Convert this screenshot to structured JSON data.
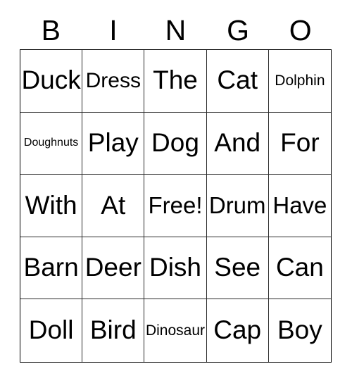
{
  "card": {
    "header_letters": [
      "B",
      "I",
      "N",
      "G",
      "O"
    ],
    "columns": 5,
    "rows": 5,
    "free_space_label": "Free!",
    "free_space_position": {
      "row": 3,
      "col": 3
    },
    "colors": {
      "background": "#ffffff",
      "text": "#000000",
      "outer_border": "#000000",
      "inner_border": "#2b2b2b"
    },
    "cells": [
      [
        {
          "text": "Duck",
          "size": "xl"
        },
        {
          "text": "Dress",
          "size": "md"
        },
        {
          "text": "The",
          "size": "xl"
        },
        {
          "text": "Cat",
          "size": "xl"
        },
        {
          "text": "Dolphin",
          "size": "sm"
        }
      ],
      [
        {
          "text": "Doughnuts",
          "size": "xs"
        },
        {
          "text": "Play",
          "size": "xl"
        },
        {
          "text": "Dog",
          "size": "xl"
        },
        {
          "text": "And",
          "size": "xl"
        },
        {
          "text": "For",
          "size": "xl"
        }
      ],
      [
        {
          "text": "With",
          "size": "xl"
        },
        {
          "text": "At",
          "size": "xl"
        },
        {
          "text": "Free!",
          "size": "lg"
        },
        {
          "text": "Drum",
          "size": "lg"
        },
        {
          "text": "Have",
          "size": "lg"
        }
      ],
      [
        {
          "text": "Barn",
          "size": "xl"
        },
        {
          "text": "Deer",
          "size": "xl"
        },
        {
          "text": "Dish",
          "size": "xl"
        },
        {
          "text": "See",
          "size": "xl"
        },
        {
          "text": "Can",
          "size": "xl"
        }
      ],
      [
        {
          "text": "Doll",
          "size": "xl"
        },
        {
          "text": "Bird",
          "size": "xl"
        },
        {
          "text": "Dinosaur",
          "size": "sm"
        },
        {
          "text": "Cap",
          "size": "xl"
        },
        {
          "text": "Boy",
          "size": "xl"
        }
      ]
    ]
  }
}
